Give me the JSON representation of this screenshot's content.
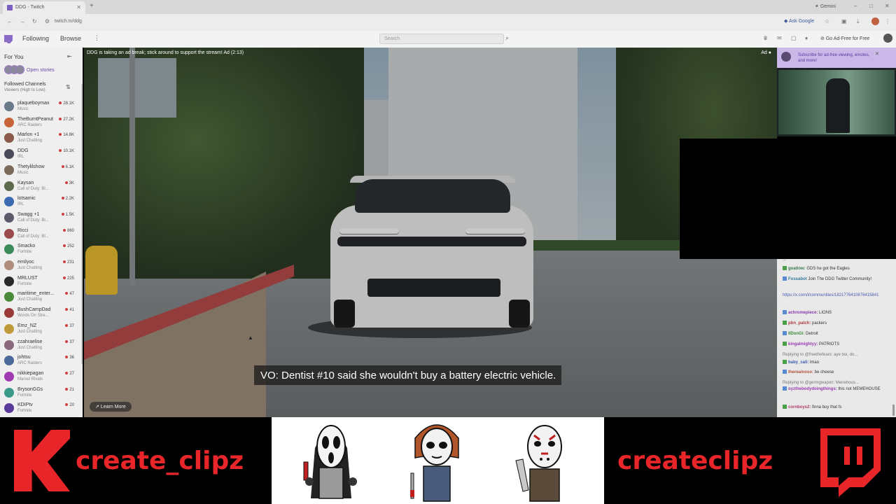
{
  "browser": {
    "tab_title": "DDG - Twitch",
    "url": "twitch.tv/ddg",
    "gemini_label": "Gemini",
    "ask_google": "Ask Google"
  },
  "topnav": {
    "following": "Following",
    "browse": "Browse",
    "search_placeholder": "Search",
    "ad_free": "Go Ad-Free for Free"
  },
  "sidebar": {
    "title": "For You",
    "stories_label": "Open stories",
    "followed_title": "Followed Channels",
    "followed_sort": "Viewers (High to Low)",
    "channels": [
      {
        "name": "plaqueboymax",
        "category": "Music",
        "viewers": "28.1K",
        "color": "#6a7a8a"
      },
      {
        "name": "TheBurntPeanut",
        "category": "ARC Raiders",
        "viewers": "27.2K",
        "color": "#c8643a"
      },
      {
        "name": "Marlon +1",
        "category": "Just Chatting",
        "viewers": "14.8K",
        "color": "#8a5a4a"
      },
      {
        "name": "DDG",
        "category": "IRL",
        "viewers": "10.1K",
        "color": "#4a4a5a"
      },
      {
        "name": "Thetylilshow",
        "category": "Music",
        "viewers": "6.1K",
        "color": "#7a6a5a"
      },
      {
        "name": "Kaysan",
        "category": "Call of Duty: Bl...",
        "viewers": "3K",
        "color": "#5a6a4a"
      },
      {
        "name": "lotsamic",
        "category": "IRL",
        "viewers": "2.2K",
        "color": "#3a6ab0"
      },
      {
        "name": "Swagg +1",
        "category": "Call of Duty: Bl...",
        "viewers": "1.5K",
        "color": "#5a5a6a"
      },
      {
        "name": "Ricci",
        "category": "Call of Duty: Bl...",
        "viewers": "860",
        "color": "#9a4a4a"
      },
      {
        "name": "Smacko",
        "category": "Fortnite",
        "viewers": "252",
        "color": "#3a8a5a"
      },
      {
        "name": "emilyoc",
        "category": "Just Chatting",
        "viewers": "231",
        "color": "#b08a7a"
      },
      {
        "name": "MRLUST",
        "category": "Fortnite",
        "viewers": "225",
        "color": "#2a2a2a"
      },
      {
        "name": "maritime_enter...",
        "category": "Just Chatting",
        "viewers": "47",
        "color": "#4a8a3a"
      },
      {
        "name": "BushCampDad",
        "category": "Words On Stre...",
        "viewers": "41",
        "color": "#9a3a3a"
      },
      {
        "name": "Emz_NZ",
        "category": "Just Chatting",
        "viewers": "37",
        "color": "#c09a3a"
      },
      {
        "name": "zzahraelise",
        "category": "Just Chatting",
        "viewers": "37",
        "color": "#8a6a7a"
      },
      {
        "name": "johtsu",
        "category": "ARC Raiders",
        "viewers": "36",
        "color": "#4a6a9a"
      },
      {
        "name": "nikkiepagan",
        "category": "Marvel Rivals",
        "viewers": "27",
        "color": "#a03ab0"
      },
      {
        "name": "BrysonGGs",
        "category": "Fortnite",
        "viewers": "21",
        "color": "#3a9a8a"
      },
      {
        "name": "KDIPtv",
        "category": "Fortnite",
        "viewers": "20",
        "color": "#5a3a9a"
      }
    ]
  },
  "player": {
    "ad_notice": "DDG is taking an ad break; stick around to support the stream! Ad (2:13)",
    "ad_tag": "Ad",
    "caption": "VO: Dentist #10 said she wouldn't buy a battery electric vehicle.",
    "learn_more": "Learn More"
  },
  "promo": {
    "text": "Subscribe for ad-free viewing, emotes, and more!"
  },
  "chat": {
    "messages": [
      {
        "user": "",
        "text": "...",
        "color": "#555"
      },
      {
        "user": "goatlow:",
        "text": " GDS he got the Eagles",
        "color": "#3a7a4a"
      },
      {
        "user": "Fossabot",
        "text": " Join The DDG Twitter Community!",
        "color": "#3a7a9a"
      },
      {
        "user": "",
        "text": "https://x.com/i/communities/1821776410876415841",
        "color": "#4a5ab0"
      },
      {
        "user": "achromepiece:",
        "text": " LIONS",
        "color": "#8a3ab0"
      },
      {
        "user": "pbn_patch:",
        "text": " packers",
        "color": "#b03a3a"
      },
      {
        "user": "IlDonGi:",
        "text": " Detroit",
        "color": "#3a8a3a"
      },
      {
        "user": "kingalmightyy:",
        "text": " PATRIOTS",
        "color": "#9a3ab0"
      },
      {
        "user": "",
        "text": "Replying to @freethefears: aye boi, do...",
        "color": "#777"
      },
      {
        "user": "baby_cali:",
        "text": " lmao",
        "color": "#3a5ab0"
      },
      {
        "user": "thereainoso:",
        "text": " be cheese",
        "color": "#b0503a"
      },
      {
        "user": "",
        "text": "Replying to @germgwapon: Menehous...",
        "color": "#777"
      },
      {
        "user": "oyzthebodydoingthings:",
        "text": " this not MEMEHOUSE",
        "color": "#9a3ab0"
      },
      {
        "user": "cornboys2:",
        "text": " finna buy that fs",
        "color": "#b03a6a"
      }
    ]
  },
  "banner": {
    "brand_left": "create_clipz",
    "brand_right": "createclipz"
  },
  "colors": {
    "accent": "#8a6cc8",
    "brand_red": "#e8262a"
  }
}
